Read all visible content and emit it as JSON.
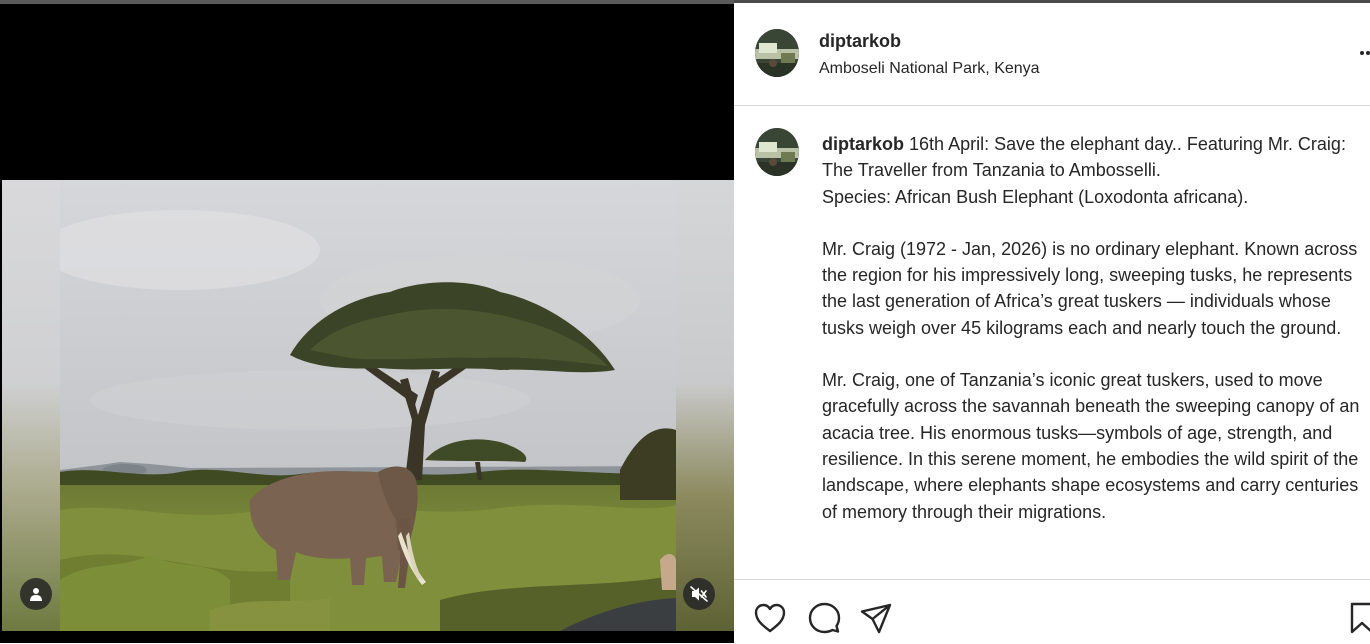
{
  "post": {
    "username": "diptarkob",
    "location": "Amboseli National Park, Kenya",
    "caption_user": "diptarkob",
    "caption_paragraphs": [
      "16th April: Save the elephant day.. Featuring Mr. Craig: The Traveller from Tanzania to Ambosselli.\nSpecies: African Bush Elephant (Loxodonta africana).",
      "Mr. Craig (1972 - Jan, 2026) is no ordinary elephant. Known across the region for his impressively long, sweeping tusks, he represents the last generation of Africa’s great tuskers — individuals whose tusks weigh over 45 kilograms each and nearly touch the ground.",
      "Mr. Craig, one of Tanzania’s iconic great tuskers, used to move gracefully across the savannah beneath the sweeping canopy of an acacia tree. His enormous tusks—symbols of age, strength, and resilience. In this serene moment, he embodies the wild spirit of the landscape, where elephants shape ecosystems and carry centuries of memory through their migrations."
    ]
  },
  "media": {
    "subject": "elephant under acacia tree on savannah",
    "muted": true
  },
  "icons": {
    "tagged_user": "user-icon",
    "sound": "volume-muted-icon",
    "more": "more-horizontal-icon",
    "like": "heart-icon",
    "comment": "comment-icon",
    "share": "send-icon",
    "save": "bookmark-icon"
  },
  "colors": {
    "text": "#262626",
    "divider": "#dbdbdb",
    "media_background": "#000000"
  }
}
